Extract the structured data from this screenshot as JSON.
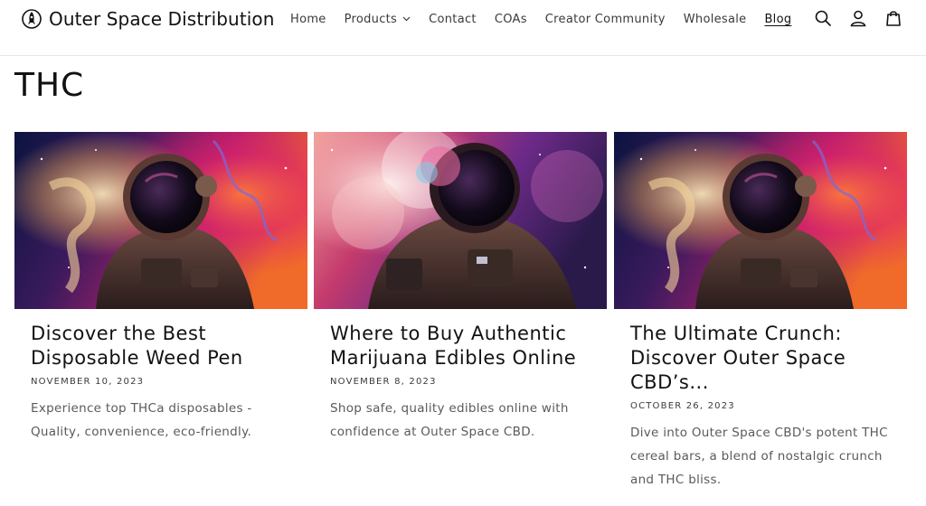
{
  "header": {
    "brand": "Outer Space Distribution",
    "nav": [
      {
        "label": "Home"
      },
      {
        "label": "Products"
      },
      {
        "label": "Contact"
      },
      {
        "label": "COAs"
      },
      {
        "label": "Creator Community"
      },
      {
        "label": "Wholesale"
      },
      {
        "label": "Blog"
      }
    ],
    "icons": [
      "search-icon",
      "account-icon",
      "cart-icon"
    ]
  },
  "page": {
    "title": "THC"
  },
  "articles": [
    {
      "title": "Discover the Best Disposable Weed Pen",
      "date": "NOVEMBER 10, 2023",
      "excerpt": "Experience top THCa disposables - Quality, convenience, eco-friendly."
    },
    {
      "title": "Where to Buy Authentic Marijuana Edibles Online",
      "date": "NOVEMBER 8, 2023",
      "excerpt": "Shop safe, quality edibles online with confidence at Outer Space CBD."
    },
    {
      "title": "The Ultimate Crunch: Discover Outer Space CBD’s...",
      "date": "OCTOBER 26, 2023",
      "excerpt": "Dive into Outer Space CBD's potent THC cereal bars, a blend of nostalgic crunch and THC bliss."
    }
  ],
  "colors": {
    "text": "#121212",
    "muted": "#5a5a5a",
    "border": "#e8e8e8"
  }
}
